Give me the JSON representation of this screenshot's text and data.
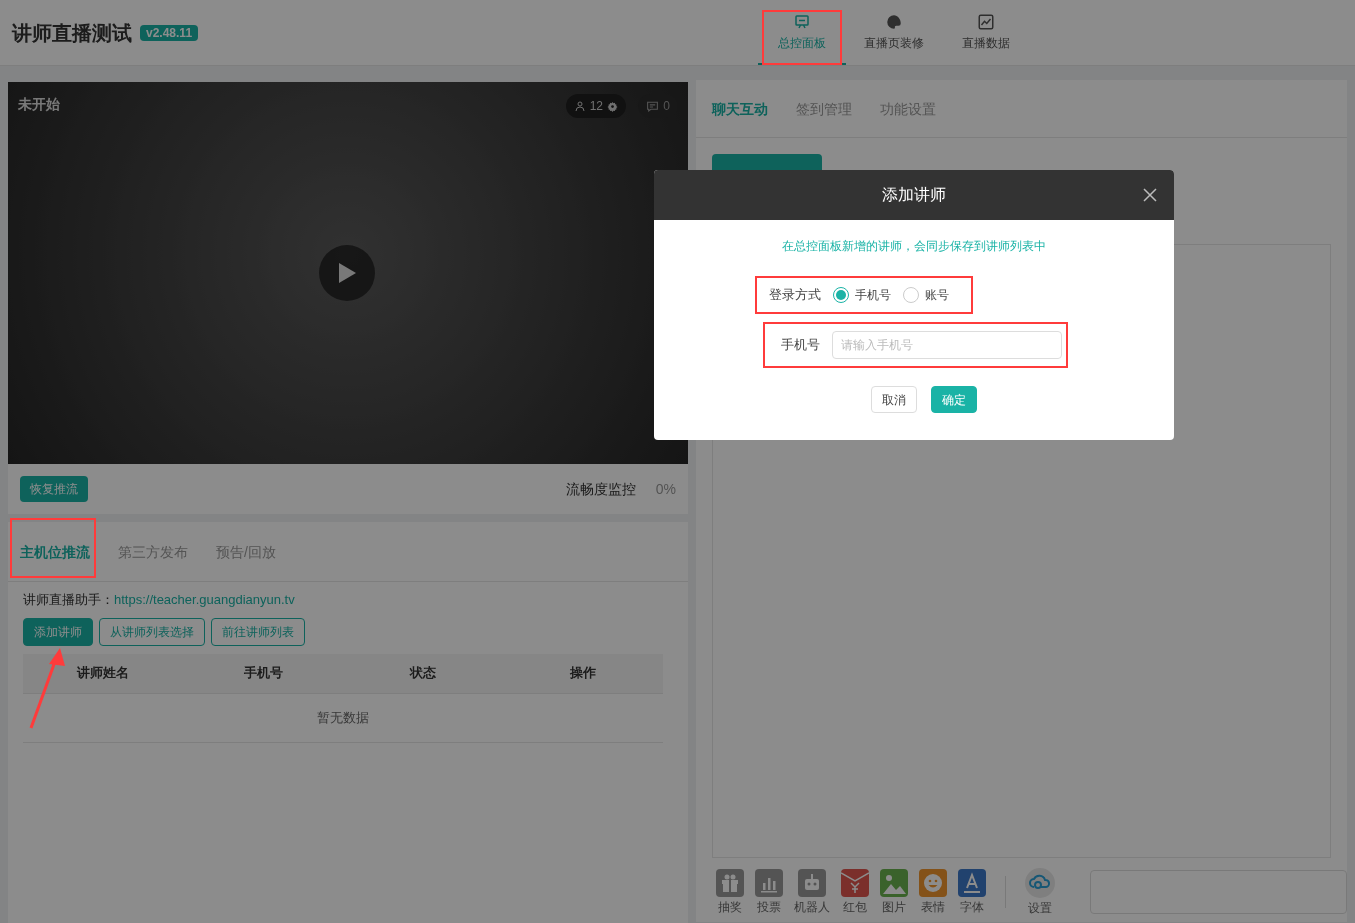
{
  "header": {
    "title": "讲师直播测试",
    "version": "v2.48.11",
    "nav": [
      {
        "label": "总控面板",
        "selected": true,
        "highlighted": true
      },
      {
        "label": "直播页装修",
        "selected": false,
        "highlighted": false
      },
      {
        "label": "直播数据",
        "selected": false,
        "highlighted": false
      }
    ]
  },
  "player": {
    "status": "未开始",
    "viewers": "12",
    "comments": "0",
    "resume_button": "恢复推流",
    "monitor_label": "流畅度监控",
    "monitor_value": "0%"
  },
  "stream_tabs": [
    {
      "label": "主机位推流",
      "selected": true,
      "highlighted": true
    },
    {
      "label": "第三方发布",
      "selected": false,
      "highlighted": false
    },
    {
      "label": "预告/回放",
      "selected": false,
      "highlighted": false
    }
  ],
  "assistant": {
    "label": "讲师直播助手：",
    "link": "https://teacher.guangdianyun.tv"
  },
  "teacher_buttons": [
    {
      "label": "添加讲师",
      "kind": "primary",
      "pointed": true
    },
    {
      "label": "从讲师列表选择",
      "kind": "outline",
      "pointed": false
    },
    {
      "label": "前往讲师列表",
      "kind": "outline",
      "pointed": false
    }
  ],
  "teacher_table": {
    "columns": [
      "讲师姓名",
      "手机号",
      "状态",
      "操作"
    ],
    "empty": "暂无数据"
  },
  "right_tabs": [
    {
      "label": "聊天互动",
      "selected": true
    },
    {
      "label": "签到管理",
      "selected": false
    },
    {
      "label": "功能设置",
      "selected": false
    }
  ],
  "tools": [
    {
      "label": "抽奖"
    },
    {
      "label": "投票"
    },
    {
      "label": "机器人"
    },
    {
      "label": "红包"
    },
    {
      "label": "图片"
    },
    {
      "label": "表情"
    },
    {
      "label": "字体"
    },
    {
      "label": "设置"
    }
  ],
  "dialog": {
    "title": "添加讲师",
    "notice": "在总控面板新增的讲师，会同步保存到讲师列表中",
    "login_label": "登录方式",
    "login_options": [
      {
        "label": "手机号",
        "selected": true
      },
      {
        "label": "账号",
        "selected": false
      }
    ],
    "login_highlighted": true,
    "phone_label": "手机号",
    "phone_placeholder": "请输入手机号",
    "phone_highlighted": true,
    "buttons": [
      {
        "label": "取消",
        "kind": "default"
      },
      {
        "label": "确定",
        "kind": "primary"
      }
    ]
  }
}
